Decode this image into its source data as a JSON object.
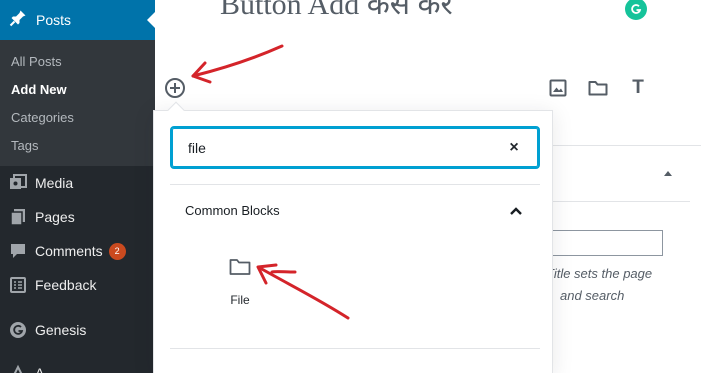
{
  "editor": {
    "title": "Button Add कैसे करें"
  },
  "sidebar": {
    "active": {
      "label": "Posts",
      "icon": "pin-icon"
    },
    "submenu": [
      {
        "label": "All Posts",
        "current": false
      },
      {
        "label": "Add New",
        "current": true
      },
      {
        "label": "Categories",
        "current": false
      },
      {
        "label": "Tags",
        "current": false
      }
    ],
    "items": [
      {
        "label": "Media",
        "icon": "media-icon"
      },
      {
        "label": "Pages",
        "icon": "pages-icon"
      },
      {
        "label": "Comments",
        "icon": "comments-icon",
        "badge": "2"
      },
      {
        "label": "Feedback",
        "icon": "feedback-icon"
      },
      {
        "label": "Genesis",
        "icon": "genesis-icon"
      },
      {
        "label": "A",
        "icon": "appearance-icon"
      }
    ]
  },
  "toolbar": {
    "icons": [
      "image-icon",
      "folder-icon",
      "text-icon"
    ],
    "text_icon_glyph": "T"
  },
  "inserter": {
    "search": {
      "value": "file",
      "clear_glyph": "×"
    },
    "section": {
      "title": "Common Blocks",
      "toggle_icon": "chevron-up-icon"
    },
    "blocks": [
      {
        "label": "File",
        "icon": "folder-icon"
      }
    ]
  },
  "settings_panel": {
    "help_line1": "Title sets the page",
    "help_line2": "and search"
  },
  "colors": {
    "sidebar_bg": "#23282d",
    "submenu_bg": "#32373c",
    "active_blue": "#0073aa",
    "search_focus": "#00a0d2",
    "badge": "#ca4a1f",
    "annotation_red": "#d4242a",
    "grammarly": "#15c39a"
  }
}
